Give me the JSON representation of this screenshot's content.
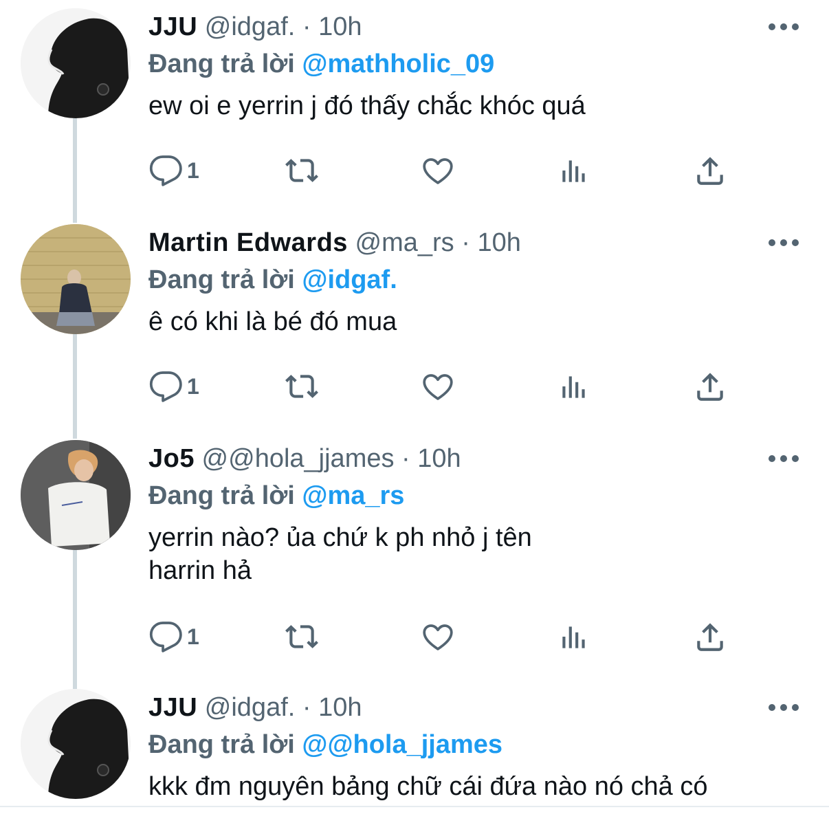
{
  "tweets": [
    {
      "name": "JJU",
      "handle": "@idgaf.",
      "separator": "·",
      "time": "10h",
      "reply_label": "Đang trả lời",
      "reply_target": "@mathholic_09",
      "text": "ew oi e yerrin j đó thấy chắc khóc quá",
      "reply_count": "1",
      "avatar_color": "#1a1a1a"
    },
    {
      "name": "Martin Edwards",
      "handle": "@ma_rs",
      "separator": "·",
      "time": "10h",
      "reply_label": "Đang trả lời",
      "reply_target": "@idgaf.",
      "text": "ê có khi là bé đó mua",
      "reply_count": "1",
      "avatar_color": "#b8a46a"
    },
    {
      "name": "Jo5",
      "handle": "@@hola_jjames",
      "separator": "·",
      "time": "10h",
      "reply_label": "Đang trả lời",
      "reply_target": "@ma_rs",
      "text": "yerrin nào? ủa chứ k ph nhỏ j tên harrin hả",
      "reply_count": "1",
      "avatar_color": "#6b6b6b"
    },
    {
      "name": "JJU",
      "handle": "@idgaf.",
      "separator": "·",
      "time": "10h",
      "reply_label": "Đang trả lời",
      "reply_target": "@@hola_jjames",
      "text": "kkk đm nguyên bảng chữ cái đứa nào nó chả có"
    }
  ],
  "icons": {
    "reply": "comment-icon",
    "retweet": "retweet-icon",
    "like": "heart-icon",
    "views": "analytics-icon",
    "share": "share-icon",
    "more": "more-options-icon"
  },
  "colors": {
    "accent": "#1d9bf0",
    "muted": "#536471",
    "text": "#0f1419",
    "thread_line": "#cfd9de"
  }
}
